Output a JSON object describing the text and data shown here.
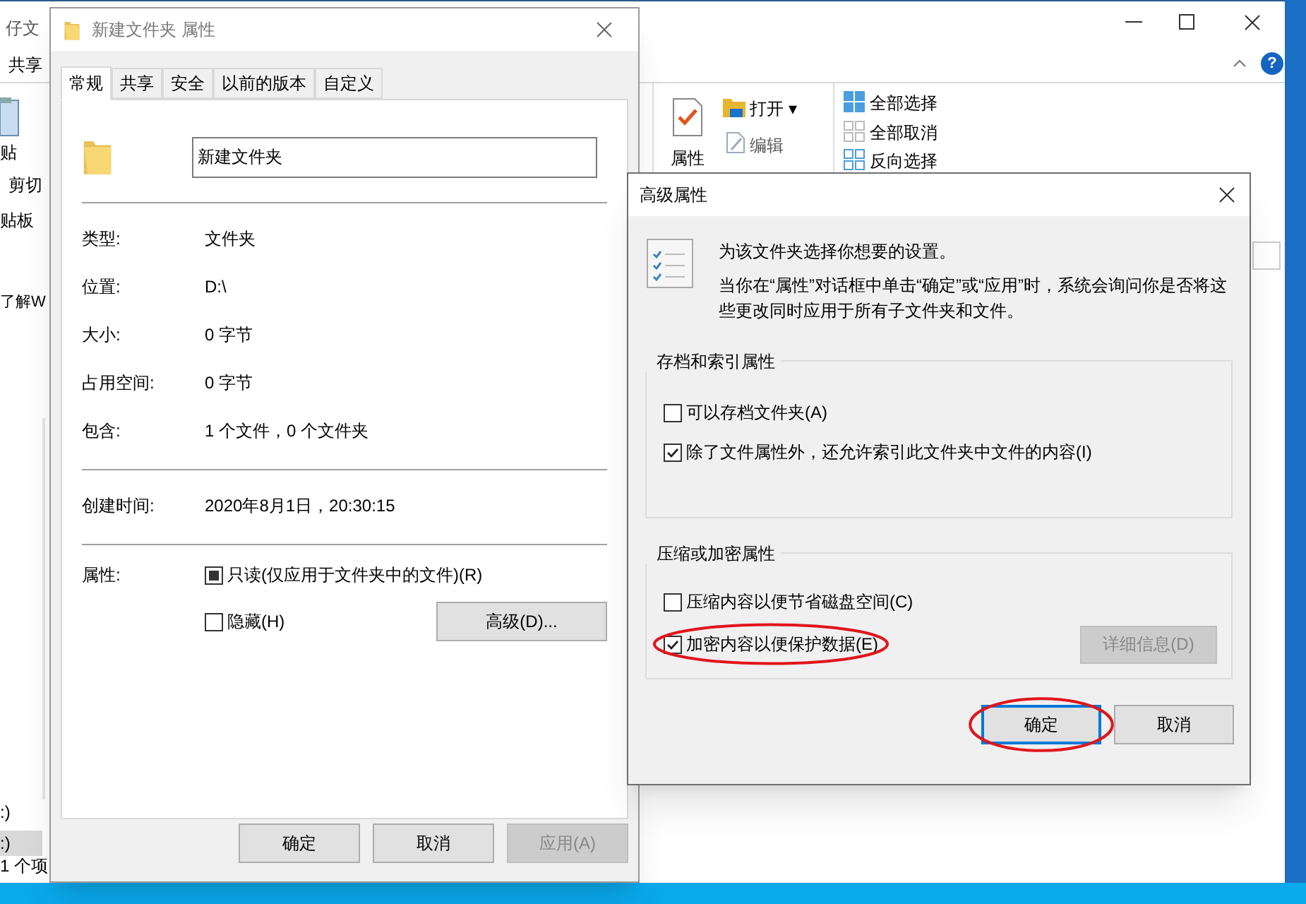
{
  "explorer": {
    "title": "仔文",
    "ribbon_tab": "共享",
    "clipboard": [
      {
        "label": "贴"
      },
      {
        "label": "剪切"
      },
      {
        "label": "贴板"
      }
    ],
    "open_group": [
      {
        "label": "属性"
      },
      {
        "label": "打开 ▾"
      },
      {
        "label": "编辑"
      }
    ],
    "select_group": [
      {
        "label": "全部选择"
      },
      {
        "label": "全部取消"
      },
      {
        "label": "反向选择"
      }
    ],
    "learn_link": "了解W",
    "help_icon": "?",
    "nav_items": [
      {
        "label": ":)",
        "selected": false
      },
      {
        "label": ":)",
        "selected": true
      }
    ],
    "status_bar": "1 个项"
  },
  "properties": {
    "title": "新建文件夹 属性",
    "tabs": [
      {
        "label": "常规",
        "selected": true
      },
      {
        "label": "共享",
        "selected": false
      },
      {
        "label": "安全",
        "selected": false
      },
      {
        "label": "以前的版本",
        "selected": false
      },
      {
        "label": "自定义",
        "selected": false
      }
    ],
    "name_value": "新建文件夹",
    "info_groups": [
      [
        {
          "label": "类型:",
          "value": "文件夹"
        },
        {
          "label": "位置:",
          "value": "D:\\"
        },
        {
          "label": "大小:",
          "value": "0 字节"
        },
        {
          "label": "占用空间:",
          "value": "0 字节"
        },
        {
          "label": "包含:",
          "value": "1 个文件，0 个文件夹"
        }
      ],
      [
        {
          "label": "创建时间:",
          "value": "2020年8月1日，20:30:15"
        }
      ]
    ],
    "attributes_label": "属性:",
    "attributes": [
      {
        "label": "只读(仅应用于文件夹中的文件)(R)",
        "indeterminate": true
      },
      {
        "label": "隐藏(H)",
        "indeterminate": false
      }
    ],
    "advanced_button": "高级(D)...",
    "buttons": [
      {
        "label": "确定",
        "disabled": false
      },
      {
        "label": "取消",
        "disabled": false
      },
      {
        "label": "应用(A)",
        "disabled": true
      }
    ]
  },
  "advanced": {
    "title": "高级属性",
    "intro": "为该文件夹选择你想要的设置。",
    "note": "当你在“属性”对话框中单击“确定”或“应用”时，系统会询问你是否将这些更改同时应用于所有子文件夹和文件。",
    "groups": [
      {
        "title": "存档和索引属性",
        "options": [
          {
            "label": "可以存档文件夹(A)",
            "checked": false,
            "annotated": false
          },
          {
            "label": "除了文件属性外，还允许索引此文件夹中文件的内容(I)",
            "checked": true,
            "annotated": false
          }
        ]
      },
      {
        "title": "压缩或加密属性",
        "options": [
          {
            "label": "压缩内容以便节省磁盘空间(C)",
            "checked": false,
            "annotated": false
          },
          {
            "label": "加密内容以便保护数据(E)",
            "checked": true,
            "annotated": true
          }
        ],
        "details_button": {
          "label": "详细信息(D)",
          "disabled": true
        }
      }
    ],
    "buttons": [
      {
        "label": "确定",
        "default": true,
        "annotated": true
      },
      {
        "label": "取消",
        "default": false,
        "annotated": false
      }
    ]
  }
}
